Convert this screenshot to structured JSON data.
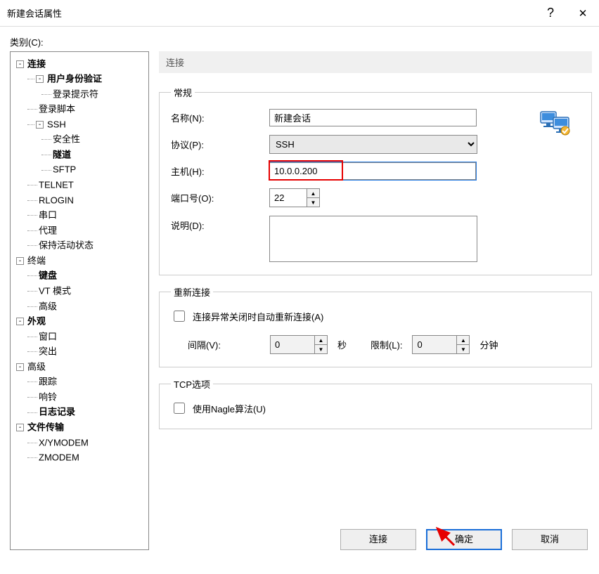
{
  "window": {
    "title": "新建会话属性",
    "help": "?",
    "close": "✕"
  },
  "category_label": "类别(C):",
  "tree": [
    {
      "id": "connection",
      "label": "连接",
      "depth": 0,
      "expandable": true,
      "expanded": true,
      "bold": true
    },
    {
      "id": "auth",
      "label": "用户身份验证",
      "depth": 1,
      "expandable": true,
      "expanded": true,
      "bold": true
    },
    {
      "id": "login-prompt",
      "label": "登录提示符",
      "depth": 2,
      "expandable": false,
      "bold": false
    },
    {
      "id": "login-script",
      "label": "登录脚本",
      "depth": 1,
      "expandable": false,
      "bold": false
    },
    {
      "id": "ssh",
      "label": "SSH",
      "depth": 1,
      "expandable": true,
      "expanded": true,
      "bold": false
    },
    {
      "id": "ssh-security",
      "label": "安全性",
      "depth": 2,
      "expandable": false,
      "bold": false
    },
    {
      "id": "ssh-tunnel",
      "label": "隧道",
      "depth": 2,
      "expandable": false,
      "bold": true
    },
    {
      "id": "ssh-sftp",
      "label": "SFTP",
      "depth": 2,
      "expandable": false,
      "bold": false
    },
    {
      "id": "telnet",
      "label": "TELNET",
      "depth": 1,
      "expandable": false,
      "bold": false
    },
    {
      "id": "rlogin",
      "label": "RLOGIN",
      "depth": 1,
      "expandable": false,
      "bold": false
    },
    {
      "id": "serial",
      "label": "串口",
      "depth": 1,
      "expandable": false,
      "bold": false
    },
    {
      "id": "proxy",
      "label": "代理",
      "depth": 1,
      "expandable": false,
      "bold": false
    },
    {
      "id": "keepalive",
      "label": "保持活动状态",
      "depth": 1,
      "expandable": false,
      "bold": false
    },
    {
      "id": "terminal",
      "label": "终端",
      "depth": 0,
      "expandable": true,
      "expanded": true,
      "bold": false
    },
    {
      "id": "keyboard",
      "label": "键盘",
      "depth": 1,
      "expandable": false,
      "bold": true
    },
    {
      "id": "vt",
      "label": "VT 模式",
      "depth": 1,
      "expandable": false,
      "bold": false
    },
    {
      "id": "term-adv",
      "label": "高级",
      "depth": 1,
      "expandable": false,
      "bold": false
    },
    {
      "id": "appearance",
      "label": "外观",
      "depth": 0,
      "expandable": true,
      "expanded": true,
      "bold": true
    },
    {
      "id": "window",
      "label": "窗口",
      "depth": 1,
      "expandable": false,
      "bold": false
    },
    {
      "id": "highlight",
      "label": "突出",
      "depth": 1,
      "expandable": false,
      "bold": false
    },
    {
      "id": "advanced",
      "label": "高级",
      "depth": 0,
      "expandable": true,
      "expanded": true,
      "bold": false
    },
    {
      "id": "trace",
      "label": "跟踪",
      "depth": 1,
      "expandable": false,
      "bold": false
    },
    {
      "id": "bell",
      "label": "响铃",
      "depth": 1,
      "expandable": false,
      "bold": false
    },
    {
      "id": "log",
      "label": "日志记录",
      "depth": 1,
      "expandable": false,
      "bold": true
    },
    {
      "id": "file-transfer",
      "label": "文件传输",
      "depth": 0,
      "expandable": true,
      "expanded": true,
      "bold": true
    },
    {
      "id": "xymodem",
      "label": "X/YMODEM",
      "depth": 1,
      "expandable": false,
      "bold": false
    },
    {
      "id": "zmodem",
      "label": "ZMODEM",
      "depth": 1,
      "expandable": false,
      "bold": false
    }
  ],
  "panel": {
    "heading": "连接",
    "general_legend": "常规",
    "name_label": "名称(N):",
    "name_value": "新建会话",
    "protocol_label": "协议(P):",
    "protocol_value": "SSH",
    "host_label": "主机(H):",
    "host_value": "10.0.0.200",
    "port_label": "端口号(O):",
    "port_value": "22",
    "desc_label": "说明(D):",
    "desc_value": "",
    "reconnect_legend": "重新连接",
    "reconnect_check_label": "连接异常关闭时自动重新连接(A)",
    "interval_label": "间隔(V):",
    "interval_value": "0",
    "interval_unit": "秒",
    "limit_label": "限制(L):",
    "limit_value": "0",
    "limit_unit": "分钟",
    "tcp_legend": "TCP选项",
    "nagle_label": "使用Nagle算法(U)"
  },
  "footer": {
    "connect": "连接",
    "ok": "确定",
    "cancel": "取消"
  }
}
